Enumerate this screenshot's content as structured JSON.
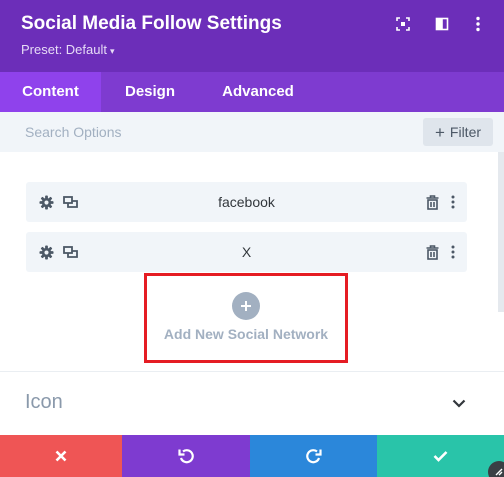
{
  "header": {
    "title": "Social Media Follow Settings",
    "preset_label": "Preset: Default",
    "preset_caret": "▾",
    "icons": [
      "focus-icon",
      "split-view-icon",
      "more-vertical-icon"
    ]
  },
  "tabs": [
    {
      "label": "Content",
      "active": true
    },
    {
      "label": "Design",
      "active": false
    },
    {
      "label": "Advanced",
      "active": false
    }
  ],
  "search": {
    "placeholder": "Search Options",
    "filter_label": "Filter",
    "filter_plus": "+"
  },
  "networks": [
    {
      "label": "facebook"
    },
    {
      "label": "X"
    }
  ],
  "add_network": {
    "plus": "+",
    "label": "Add New Social Network"
  },
  "icon_section": {
    "title": "Icon"
  },
  "footer": {
    "buttons": [
      {
        "name": "discard",
        "icon": "close-icon",
        "color": "#ef5555"
      },
      {
        "name": "undo",
        "icon": "undo-icon",
        "color": "#7e3bd0"
      },
      {
        "name": "redo",
        "icon": "redo-icon",
        "color": "#2b87da"
      },
      {
        "name": "save",
        "icon": "check-icon",
        "color": "#29c4a9"
      }
    ]
  },
  "colors": {
    "header": "#6c2eb9",
    "tabs": "#7e3bd0",
    "active_tab": "#8f42ec",
    "highlight_border": "#e51c23"
  }
}
